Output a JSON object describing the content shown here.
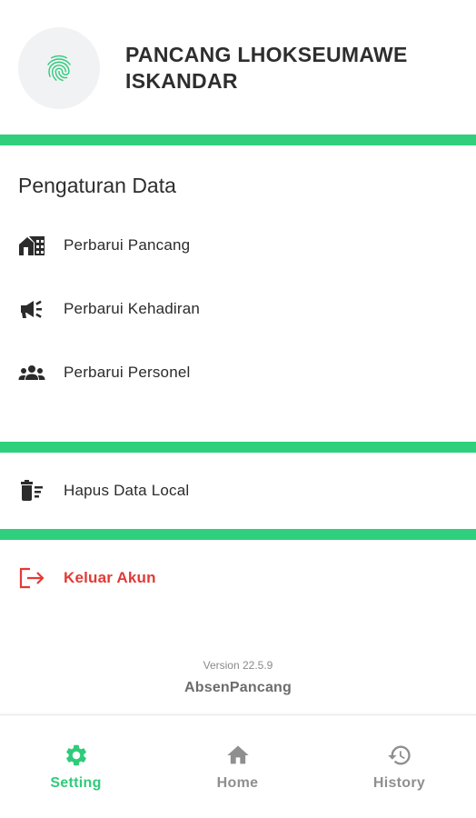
{
  "colors": {
    "accent": "#2ecc7a",
    "divider": "#2fcf7d",
    "danger": "#e53935",
    "text": "#2b2b2b",
    "nav_inactive": "#8f8f8f"
  },
  "header": {
    "avatar_icon": "fingerprint-icon",
    "title_line1": "PANCANG LHOKSEUMAWE",
    "title_line2": "ISKANDAR"
  },
  "data_settings": {
    "title": "Pengaturan Data",
    "items": [
      {
        "label": "Perbarui Pancang",
        "icon": "building-icon"
      },
      {
        "label": "Perbarui Kehadiran",
        "icon": "megaphone-icon"
      },
      {
        "label": "Perbarui Personel",
        "icon": "group-icon"
      }
    ]
  },
  "local": {
    "clear_label": "Hapus Data Local",
    "clear_icon": "delete-sweep-icon"
  },
  "account": {
    "logout_label": "Keluar Akun",
    "logout_icon": "logout-icon"
  },
  "footer": {
    "version": "Version 22.5.9",
    "app_name": "AbsenPancang"
  },
  "bottom_nav": {
    "active": "Setting",
    "items": [
      {
        "label": "Setting",
        "icon": "gear-icon"
      },
      {
        "label": "Home",
        "icon": "home-icon"
      },
      {
        "label": "History",
        "icon": "history-icon"
      }
    ]
  }
}
